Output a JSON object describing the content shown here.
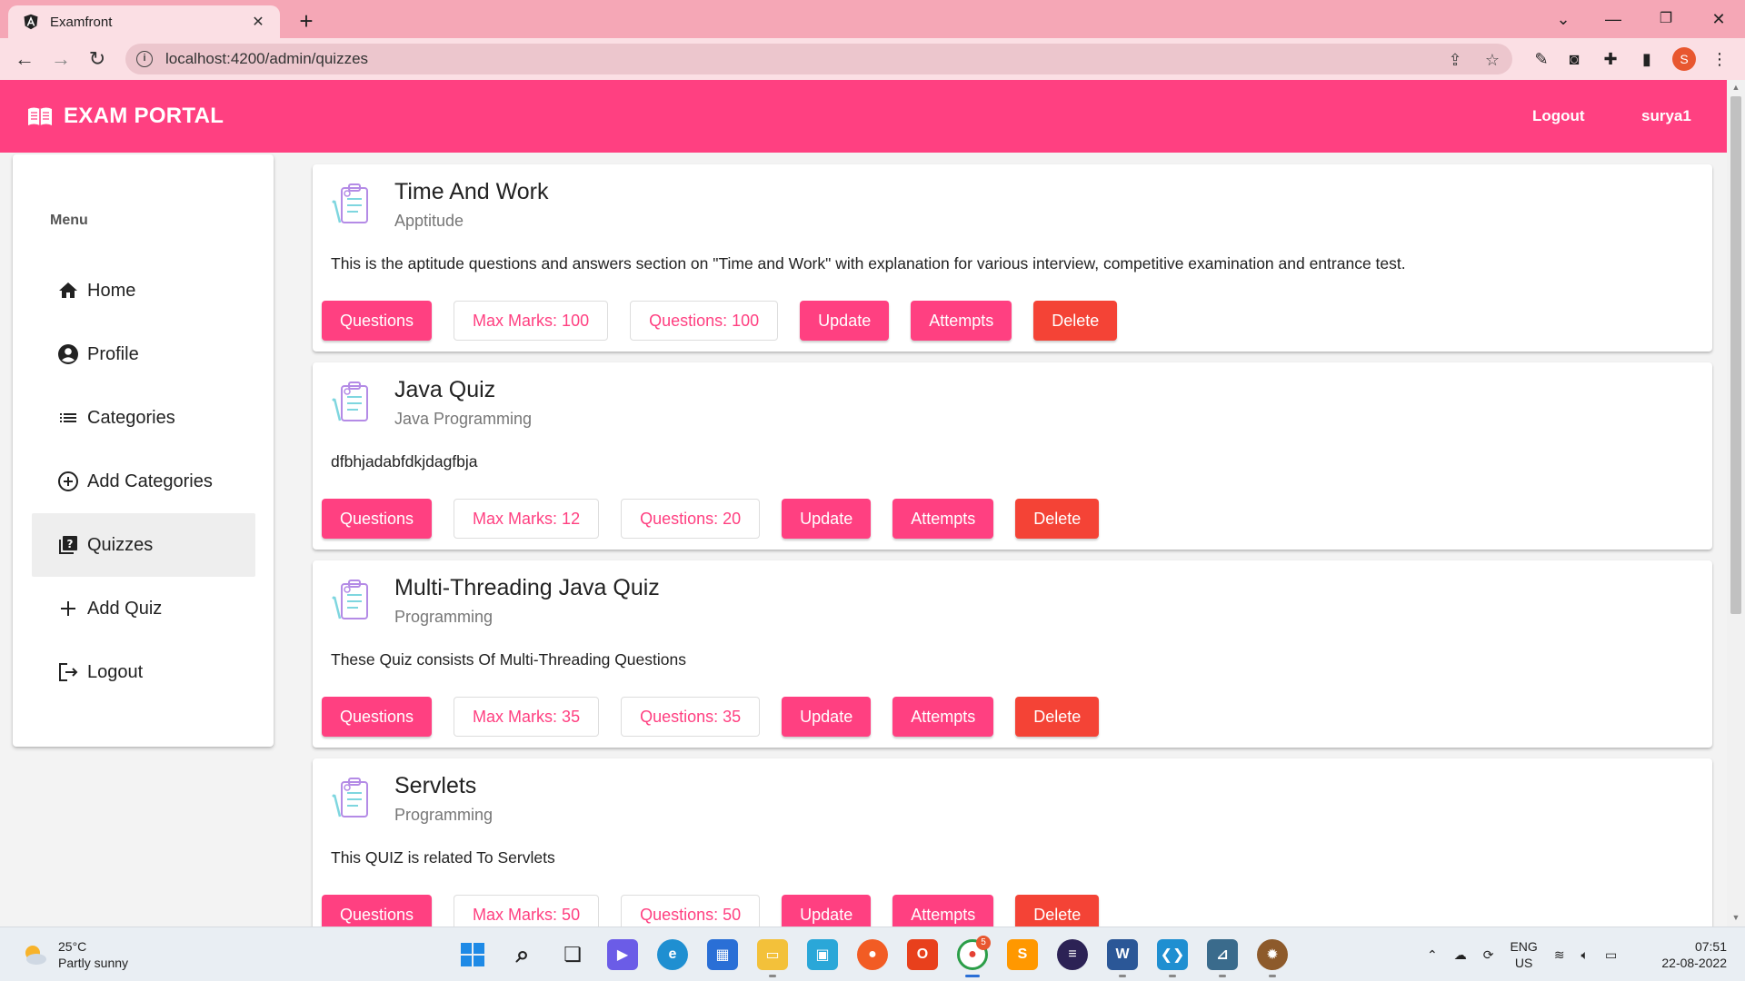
{
  "browser": {
    "tab_title": "Examfront",
    "url": "localhost:4200/admin/quizzes",
    "profile_initial": "S"
  },
  "header": {
    "brand": "EXAM PORTAL",
    "logout": "Logout",
    "username": "surya1"
  },
  "sidebar": {
    "menu_title": "Menu",
    "items": [
      {
        "label": "Home",
        "icon": "home-icon"
      },
      {
        "label": "Profile",
        "icon": "account-circle-icon"
      },
      {
        "label": "Categories",
        "icon": "list-icon"
      },
      {
        "label": "Add Categories",
        "icon": "add-circle-icon"
      },
      {
        "label": "Quizzes",
        "icon": "quiz-icon",
        "active": true
      },
      {
        "label": "Add Quiz",
        "icon": "plus-icon"
      },
      {
        "label": "Logout",
        "icon": "logout-icon"
      }
    ]
  },
  "quizzes": [
    {
      "title": "Time And Work",
      "category": "Apptitude",
      "description": "This is the aptitude questions and answers section on \"Time and Work\" with explanation for various interview, competitive examination and entrance test.",
      "questions_btn": "Questions",
      "max_marks": "Max Marks: 100",
      "num_questions": "Questions: 100",
      "update": "Update",
      "attempts": "Attempts",
      "delete": "Delete"
    },
    {
      "title": "Java Quiz",
      "category": "Java Programming",
      "description": "dfbhjadabfdkjdagfbja",
      "questions_btn": "Questions",
      "max_marks": "Max Marks: 12",
      "num_questions": "Questions: 20",
      "update": "Update",
      "attempts": "Attempts",
      "delete": "Delete"
    },
    {
      "title": "Multi-Threading Java Quiz",
      "category": "Programming",
      "description": "These Quiz consists Of Multi-Threading Questions",
      "questions_btn": "Questions",
      "max_marks": "Max Marks: 35",
      "num_questions": "Questions: 35",
      "update": "Update",
      "attempts": "Attempts",
      "delete": "Delete"
    },
    {
      "title": "Servlets",
      "category": "Programming",
      "description": "This QUIZ is related To Servlets",
      "questions_btn": "Questions",
      "max_marks": "Max Marks: 50",
      "num_questions": "Questions: 50",
      "update": "Update",
      "attempts": "Attempts",
      "delete": "Delete"
    }
  ],
  "taskbar": {
    "temperature": "25°C",
    "weather": "Partly sunny",
    "language": "ENG",
    "region": "US",
    "time": "07:51",
    "date": "22-08-2022",
    "chrome_badge": "5"
  },
  "colors": {
    "primary": "#ff4081",
    "warn": "#f44336",
    "chrome_tab": "#f5a7b6"
  }
}
